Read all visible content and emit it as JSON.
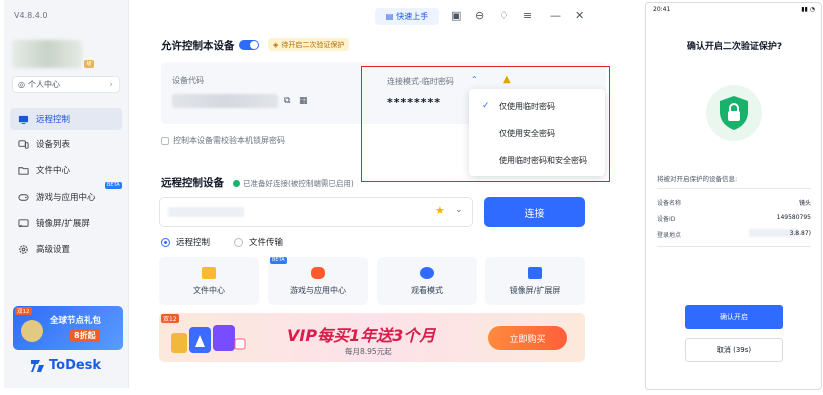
{
  "app": {
    "version": "V4.8.4.0",
    "brand": "ToDesk"
  },
  "sidebar": {
    "personal_center": "个人中心",
    "items": [
      {
        "label": "远程控制",
        "icon": "monitor-icon",
        "active": true
      },
      {
        "label": "设备列表",
        "icon": "devices-icon",
        "active": false
      },
      {
        "label": "文件中心",
        "icon": "folder-icon",
        "active": false
      },
      {
        "label": "游戏与应用中心",
        "icon": "gamepad-icon",
        "active": false,
        "badge": "BETA"
      },
      {
        "label": "镜像屏/扩展屏",
        "icon": "cast-icon",
        "active": false
      },
      {
        "label": "高级设置",
        "icon": "gear-icon",
        "active": false
      }
    ],
    "promo": {
      "tag": "双12",
      "line1": "全球节点礼包",
      "line2": "8折起"
    }
  },
  "toolbar": {
    "quick_start": "快速上手"
  },
  "allow_control": {
    "title": "允许控制本设备",
    "pending_badge": "待开启二次验证保护",
    "device_code_label": "设备代码",
    "password_label": "连接模式-临时密码",
    "password_value": "********",
    "lock_checkbox_label": "控制本设备需校验本机锁屏密码"
  },
  "password_menu": {
    "options": [
      {
        "label": "仅使用临时密码",
        "checked": true
      },
      {
        "label": "仅使用安全密码",
        "checked": false
      },
      {
        "label": "使用临时密码和安全密码",
        "checked": false
      }
    ]
  },
  "remote_control": {
    "title": "远程控制设备",
    "status": "已准备好连接(被控制端需已启用)",
    "connect_label": "连接",
    "modes": [
      {
        "label": "远程控制",
        "selected": true
      },
      {
        "label": "文件传输",
        "selected": false
      }
    ],
    "tiles": [
      {
        "label": "文件中心",
        "icon": "folder-icon"
      },
      {
        "label": "游戏与应用中心",
        "icon": "gamepad-icon",
        "badge": "BETA"
      },
      {
        "label": "观看模式",
        "icon": "eye-icon"
      },
      {
        "label": "镜像屏/扩展屏",
        "icon": "cast-icon"
      }
    ]
  },
  "vip_banner": {
    "tag": "双12",
    "headline": "VIP每买1年送3个月",
    "sub": "每月8.95元起",
    "button": "立即购买"
  },
  "phone": {
    "time": "20:41",
    "title": "确认开启二次验证保护?",
    "description": "将被对开启保护的设备信息:",
    "rows": [
      {
        "key": "设备名称",
        "value": "镜头"
      },
      {
        "key": "设备ID",
        "value": "149580795"
      },
      {
        "key": "登录地点",
        "value": "3.8.87)"
      }
    ],
    "confirm": "确认开启",
    "cancel": "取消 (39s)"
  },
  "colors": {
    "primary": "#2f6bff",
    "danger_outline": "#e0242b",
    "success": "#19b36b",
    "warning": "#e0a400"
  }
}
